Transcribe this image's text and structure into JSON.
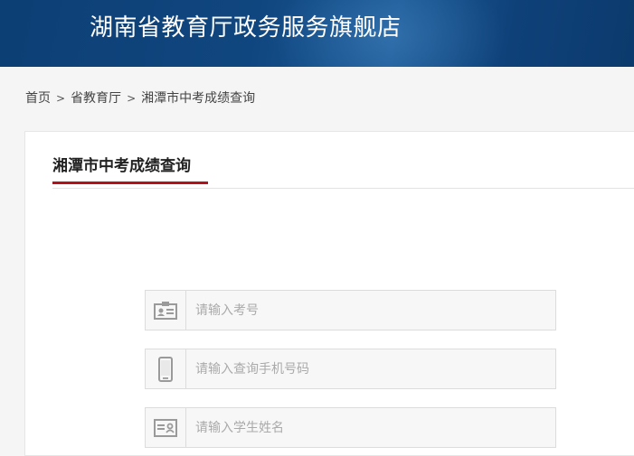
{
  "header": {
    "title": "湖南省教育厅政务服务旗舰店"
  },
  "breadcrumb": {
    "items": [
      "首页",
      "省教育厅",
      "湘潭市中考成绩查询"
    ],
    "separator": ">"
  },
  "panel": {
    "title": "湘潭市中考成绩查询",
    "accent_color": "#b3121b"
  },
  "form": {
    "fields": [
      {
        "icon": "id-card-icon",
        "placeholder": "请输入考号",
        "value": ""
      },
      {
        "icon": "mobile-phone-icon",
        "placeholder": "请输入查询手机号码",
        "value": ""
      },
      {
        "icon": "name-card-icon",
        "placeholder": "请输入学生姓名",
        "value": ""
      }
    ]
  },
  "colors": {
    "header_bg": "#0c3f74",
    "icon_gray": "#9a9a9a"
  }
}
